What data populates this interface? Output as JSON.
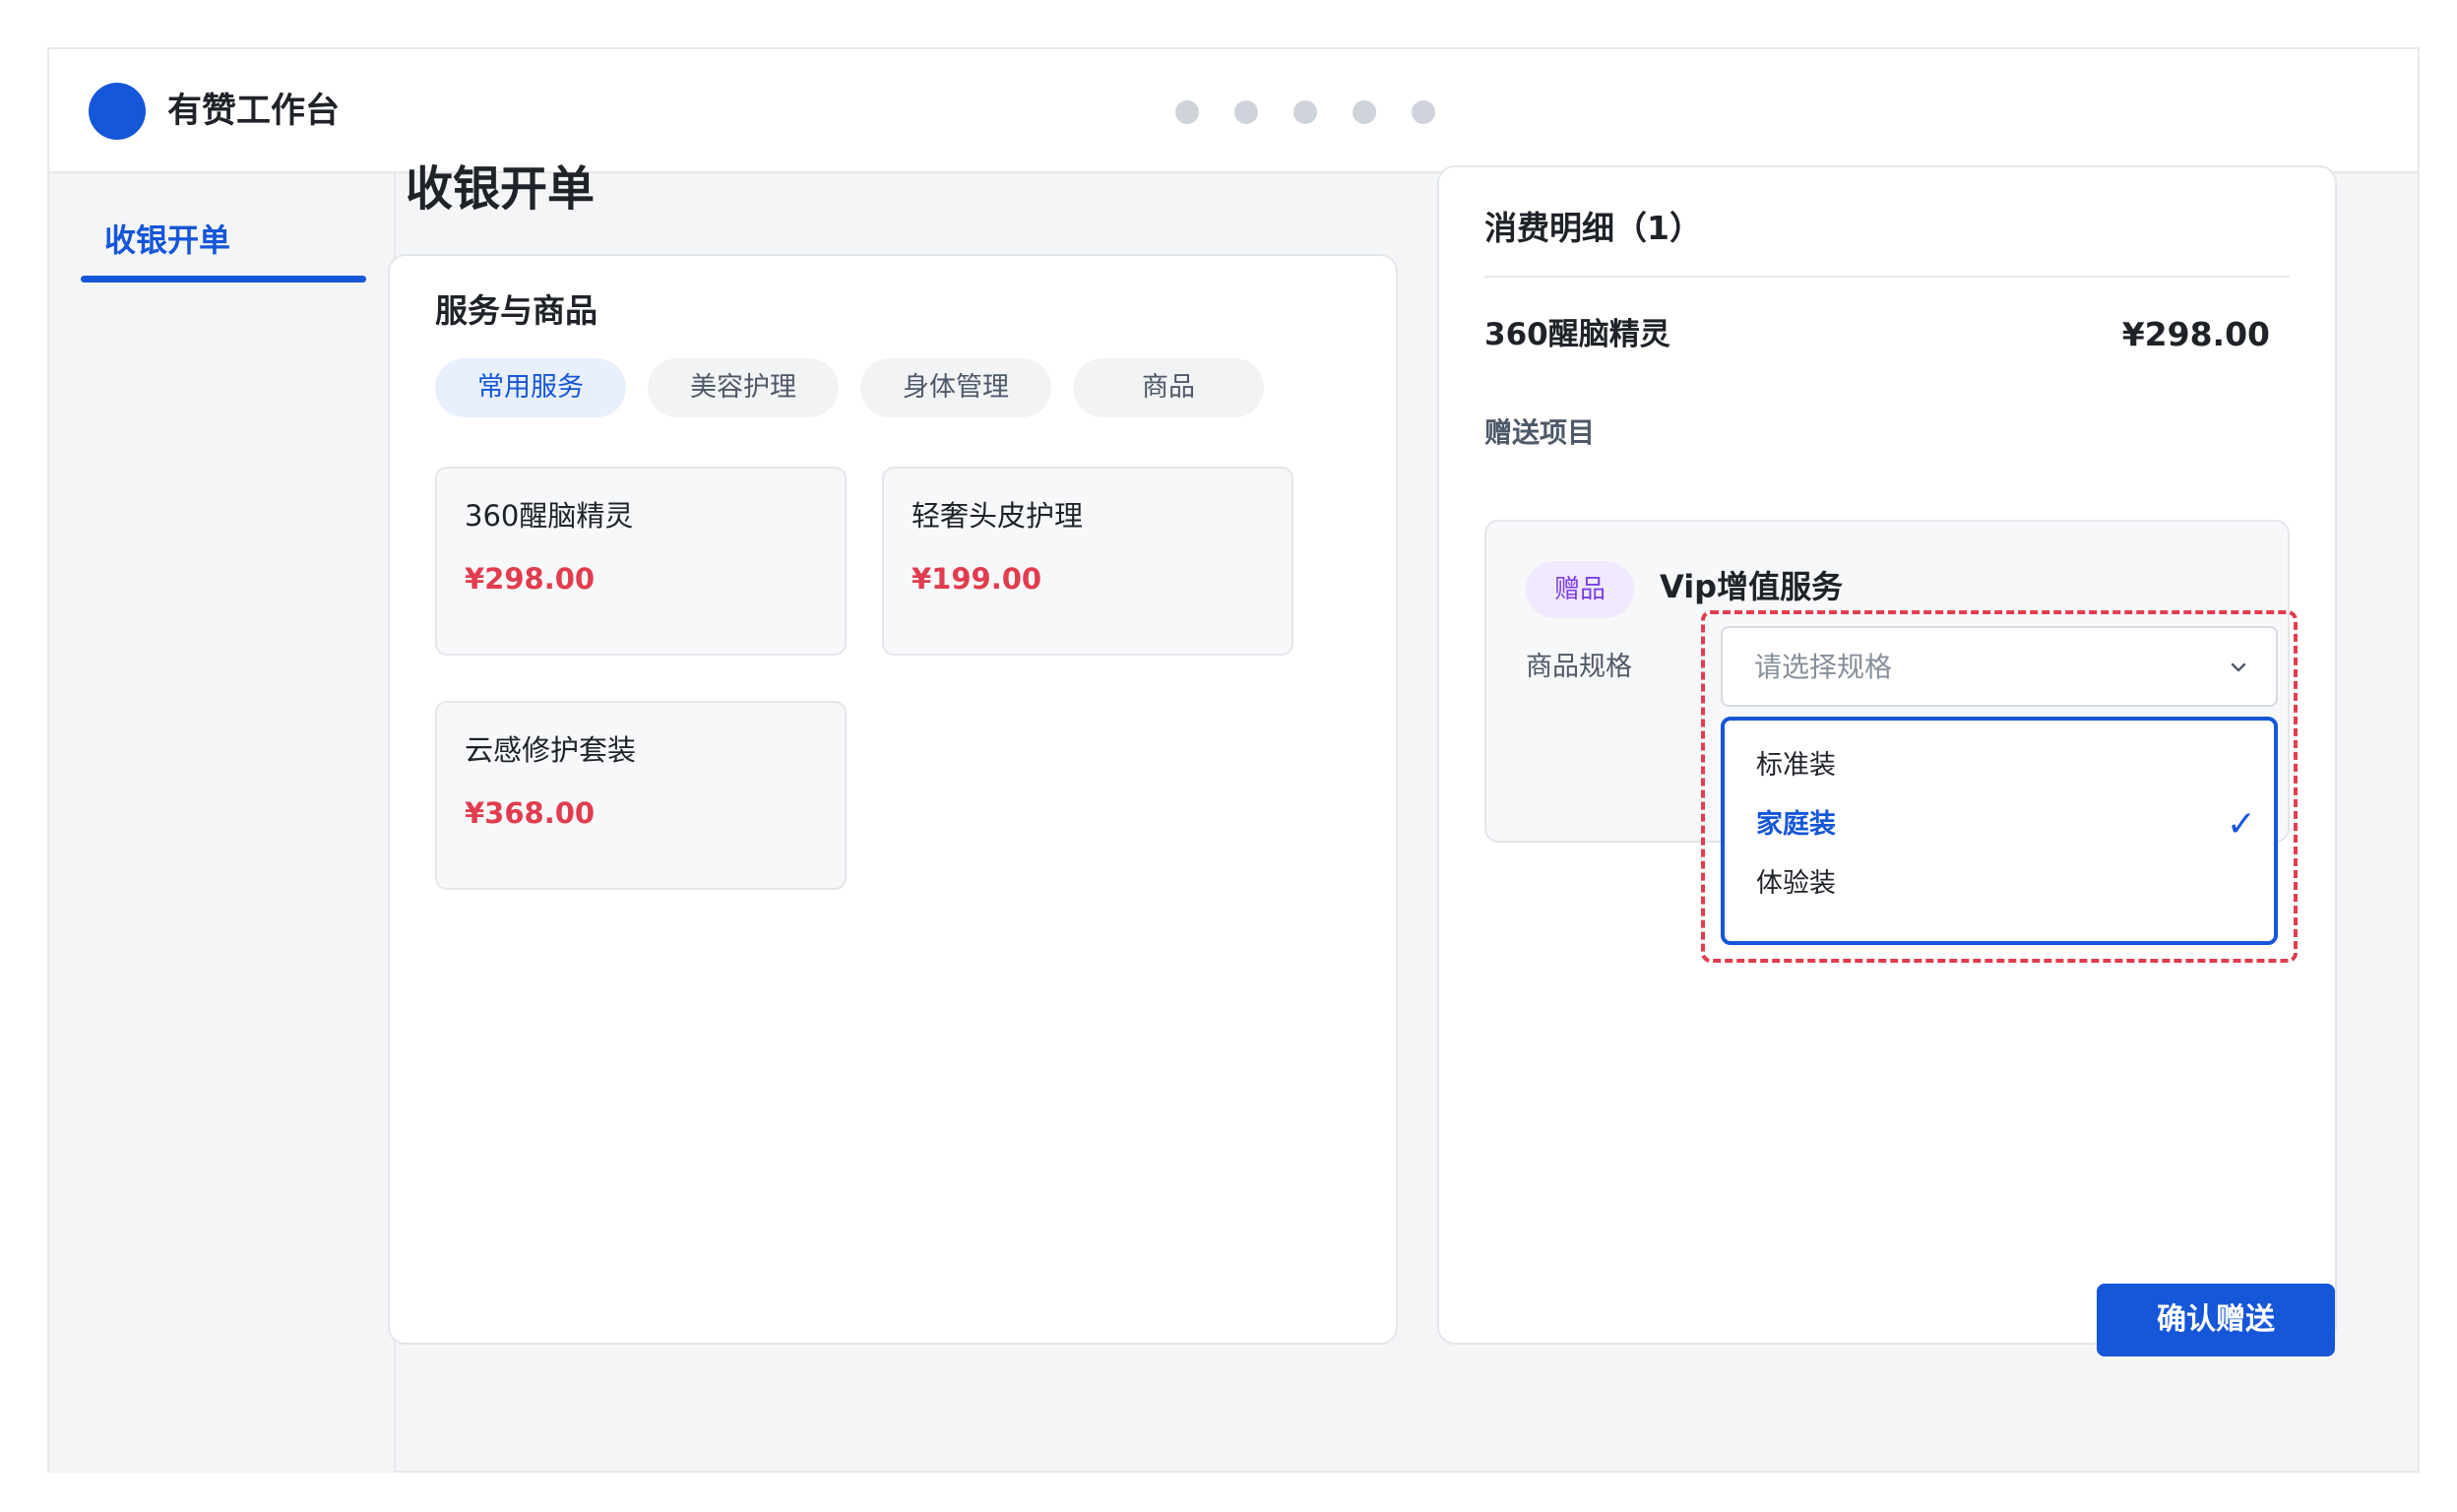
{
  "app": {
    "title": "有赞工作台"
  },
  "sidebar": {
    "items": [
      {
        "label": "收银开单",
        "active": true
      }
    ]
  },
  "page": {
    "title": "收银开单"
  },
  "services": {
    "title": "服务与商品",
    "tabs": [
      {
        "label": "常用服务",
        "active": true
      },
      {
        "label": "美容护理",
        "active": false
      },
      {
        "label": "身体管理",
        "active": false
      },
      {
        "label": "商品",
        "active": false
      }
    ],
    "items": [
      {
        "name": "360醒脑精灵",
        "price": "¥298.00"
      },
      {
        "name": "轻奢头皮护理",
        "price": "¥199.00"
      },
      {
        "name": "云感修护套装",
        "price": "¥368.00"
      }
    ]
  },
  "order": {
    "title": "消费明细（1）",
    "line": {
      "name": "360醒脑精灵",
      "price": "¥298.00"
    },
    "gift_section_label": "赠送项目",
    "gift": {
      "badge": "赠品",
      "name": "Vip增值服务",
      "spec_label": "商品规格",
      "select_placeholder": "请选择规格",
      "options": [
        {
          "label": "标准装",
          "selected": false
        },
        {
          "label": "家庭装",
          "selected": true
        },
        {
          "label": "体验装",
          "selected": false
        }
      ]
    },
    "confirm_label": "确认赠送"
  },
  "colors": {
    "accent": "#1656d8",
    "price": "#e23c4f",
    "gift_badge": "#7a3fe4",
    "highlight": "#e23c4f"
  },
  "icons": {
    "logo": "circle-logo-icon",
    "select_arrow": "chevron-down-icon",
    "selected_mark": "check-icon"
  }
}
